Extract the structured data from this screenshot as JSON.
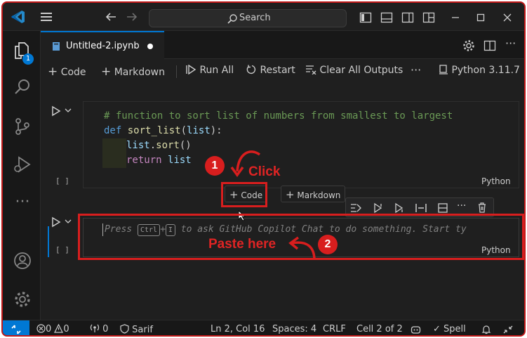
{
  "title_bar": {
    "search_placeholder": "Search"
  },
  "tab": {
    "filename": "Untitled-2.ipynb"
  },
  "activity_bar": {
    "explorer_badge": "1"
  },
  "toolbar": {
    "code": "Code",
    "markdown": "Markdown",
    "run_all": "Run All",
    "restart": "Restart",
    "clear_all_outputs": "Clear All Outputs",
    "more": "···",
    "kernel": "Python 3.11.7"
  },
  "cell1": {
    "code_lines": [
      "# function to sort list of numbers from smallest to largest",
      "def sort_list(list):",
      "list.sort()",
      "return list"
    ],
    "execution_count": "[ ]",
    "language": "Python"
  },
  "add_cell": {
    "code": "Code",
    "markdown": "Markdown"
  },
  "cell2": {
    "placeholder_press": "Press",
    "key_ctrl": "Ctrl",
    "key_plus": "+",
    "key_i": "I",
    "placeholder_rest": "to ask GitHub Copilot Chat to do something. Start ty",
    "execution_count": "[ ]",
    "language": "Python"
  },
  "annotations": {
    "step1_number": "1",
    "step1_label": "Click",
    "step2_number": "2",
    "step2_label": "Paste here",
    "accent_color": "#d81e1e"
  },
  "status_bar": {
    "errors": "0",
    "warnings": "0",
    "ports": "0",
    "sarif": "Sarif",
    "position": "Ln 2, Col 16",
    "spaces": "Spaces: 4",
    "eol": "CRLF",
    "cell": "Cell 2 of 2",
    "spell": "Spell"
  },
  "colors": {
    "accent": "#0078d4",
    "background": "#1f1f1f",
    "annotation": "#d81e1e"
  }
}
